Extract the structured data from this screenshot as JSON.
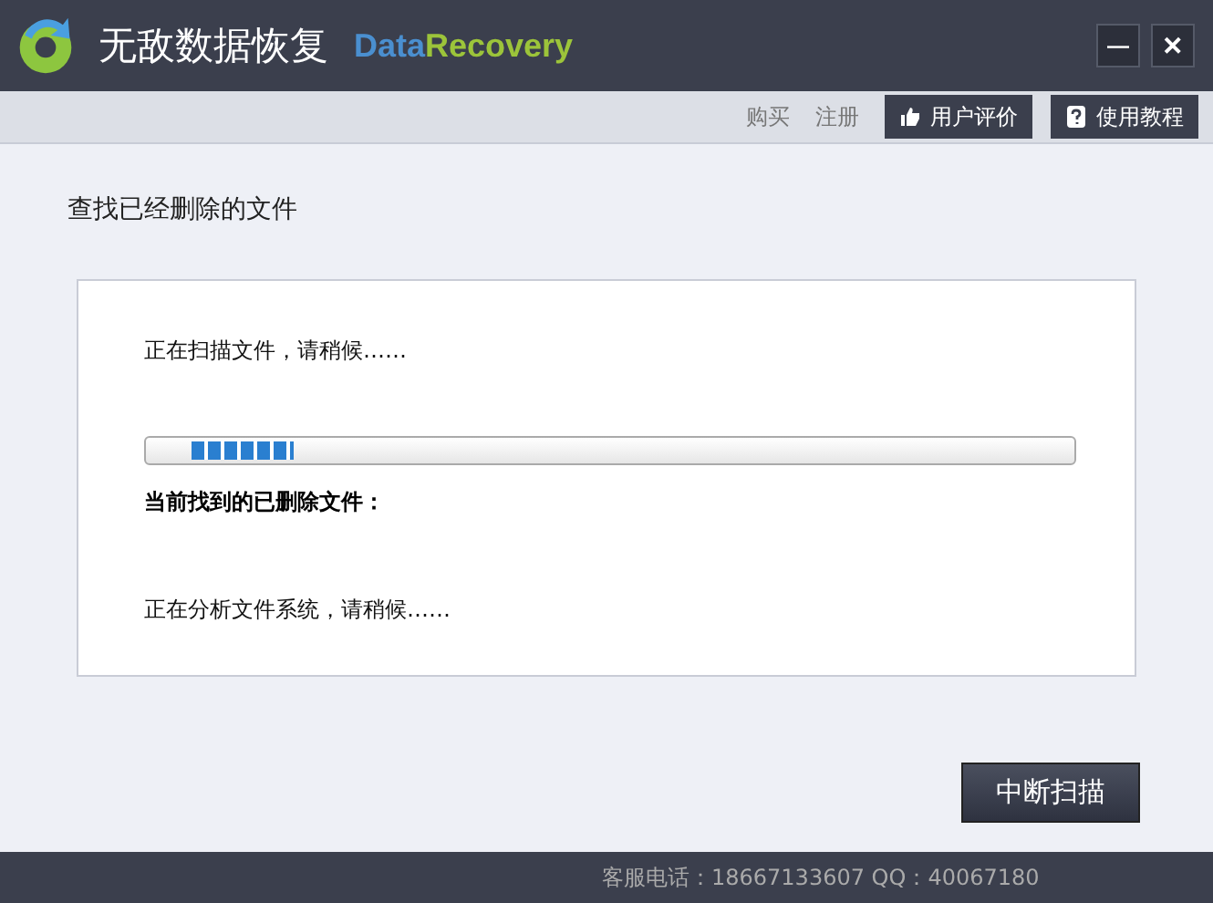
{
  "window": {
    "title": "无敌数据恢复",
    "brand_part1": "Data",
    "brand_part2": "Recovery",
    "controls": [
      {
        "label": "—",
        "kind": "minimize"
      },
      {
        "label": "✕",
        "kind": "close"
      }
    ]
  },
  "toolbar": {
    "links": [
      "购买",
      "注册"
    ],
    "buttons": [
      {
        "label": "用户评价",
        "kind": "thumb"
      },
      {
        "label": "使用教程",
        "kind": "help"
      }
    ]
  },
  "heading": "查找已经删除的文件",
  "panel": {
    "status": "正在扫描文件，请稍候……",
    "progress": {
      "level": 0.11
    },
    "found_label": "当前找到的已删除文件：",
    "analysis": "正在分析文件系统，请稍候……"
  },
  "action_button": "中断扫描",
  "status_bar": "客服电话：18667133607 QQ：40067180"
}
